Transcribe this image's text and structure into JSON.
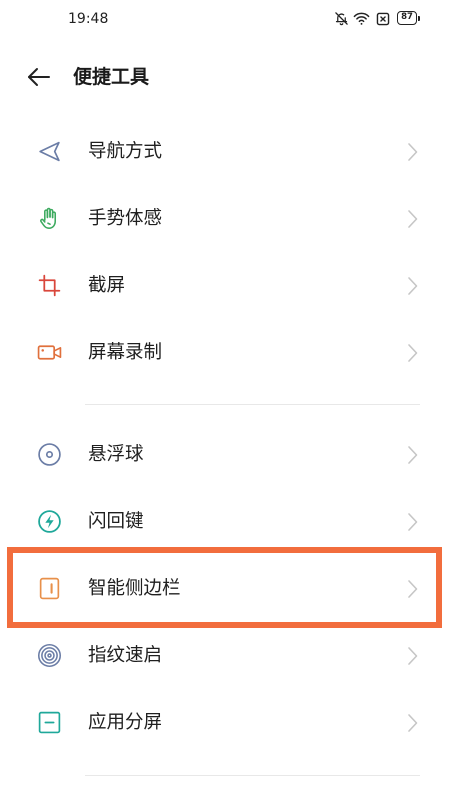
{
  "status_bar": {
    "time": "19:48",
    "battery_level": "87",
    "icons": [
      "bell-off-icon",
      "wifi-icon",
      "sim-no-signal-icon",
      "battery-icon"
    ]
  },
  "header": {
    "back_icon": "arrow-left-icon",
    "title": "便捷工具"
  },
  "groups": [
    {
      "items": [
        {
          "label": "导航方式",
          "icon": "navigation-arrow-icon",
          "icon_color": "#6B7DA6"
        },
        {
          "label": "手势体感",
          "icon": "hand-gesture-icon",
          "icon_color": "#3DAA5F"
        },
        {
          "label": "截屏",
          "icon": "screenshot-crop-icon",
          "icon_color": "#D9463B"
        },
        {
          "label": "屏幕录制",
          "icon": "screen-record-icon",
          "icon_color": "#E0703C"
        }
      ]
    },
    {
      "items": [
        {
          "label": "悬浮球",
          "icon": "floating-ball-icon",
          "icon_color": "#6B7DA6"
        },
        {
          "label": "闪回键",
          "icon": "flashback-key-icon",
          "icon_color": "#1FA89A"
        },
        {
          "label": "智能侧边栏",
          "icon": "smart-sidebar-icon",
          "icon_color": "#E8904A",
          "highlighted": true
        },
        {
          "label": "指纹速启",
          "icon": "fingerprint-icon",
          "icon_color": "#6B7DA6"
        },
        {
          "label": "应用分屏",
          "icon": "split-screen-icon",
          "icon_color": "#1FA89A"
        }
      ]
    }
  ],
  "row_chevron_icon": "chevron-right-icon",
  "highlight": {
    "color": "#F26D3D"
  }
}
